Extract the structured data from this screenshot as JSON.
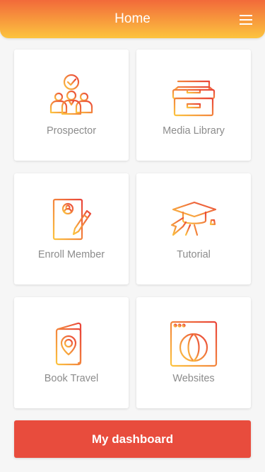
{
  "header": {
    "title": "Home",
    "menu_icon": "hamburger-menu-icon"
  },
  "tiles": [
    {
      "label": "Prospector",
      "icon": "team-prospect-icon"
    },
    {
      "label": "Media Library",
      "icon": "archive-drawer-icon"
    },
    {
      "label": "Enroll Member",
      "icon": "enroll-form-icon"
    },
    {
      "label": "Tutorial",
      "icon": "graduation-cap-icon"
    },
    {
      "label": "Book Travel",
      "icon": "passport-travel-icon"
    },
    {
      "label": "Websites",
      "icon": "globe-browser-icon"
    }
  ],
  "dashboard_button": {
    "label": "My dashboard"
  },
  "colors": {
    "header_gradient_start": "#f26a3a",
    "header_gradient_end": "#fcc43f",
    "icon_gradient_start": "#e9443a",
    "icon_gradient_end": "#fcc43f",
    "button": "#e84c3d",
    "label_text": "#8c8c8c",
    "background": "#f6f6f6"
  }
}
